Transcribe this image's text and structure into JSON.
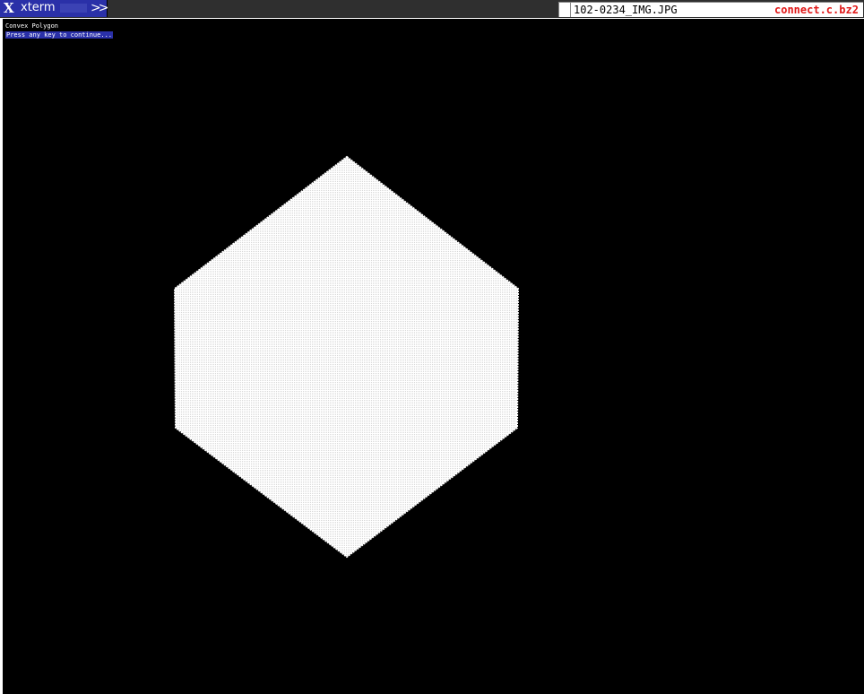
{
  "window": {
    "title": "xterm",
    "icon": "x-logo-icon",
    "more_label": ">>"
  },
  "tray": {
    "image_file": "102-0234_IMG.JPG",
    "archive_file": "connect.c.bz2"
  },
  "terminal": {
    "lines": [
      "Convex Polygon",
      "Press any key to continue..."
    ]
  },
  "drawing": {
    "shape": "convex hexagon",
    "fill": "white dithered",
    "background": "#000000"
  },
  "colors": {
    "tab_bg": "#2a30a8",
    "archive_text": "#e01818",
    "terminal_bg": "#000000",
    "terminal_fg": "#ffffff"
  }
}
